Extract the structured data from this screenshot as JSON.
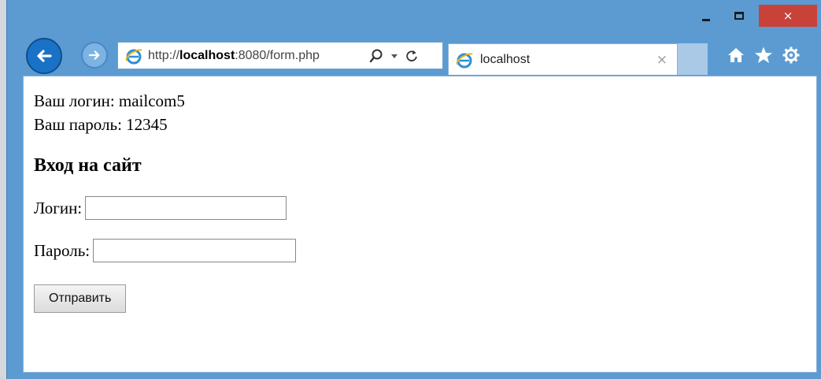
{
  "window": {
    "minimize_label": "_",
    "maximize_label": "□",
    "close_label": "×"
  },
  "address_bar": {
    "url_prefix": "http://",
    "url_host": "localhost",
    "url_suffix": ":8080/form.php"
  },
  "tab": {
    "title": "localhost",
    "close_label": "×"
  },
  "colors": {
    "frame": "#5b9bd2",
    "close": "#c8423a",
    "back_button": "#1a72c6"
  },
  "page": {
    "login_info": "Ваш логин: mailcom5",
    "password_info": "Ваш пароль: 12345",
    "heading": "Вход на сайт",
    "login_label": "Логин:",
    "login_value": "",
    "password_label": "Пароль:",
    "password_value": "",
    "submit_label": "Отправить"
  }
}
